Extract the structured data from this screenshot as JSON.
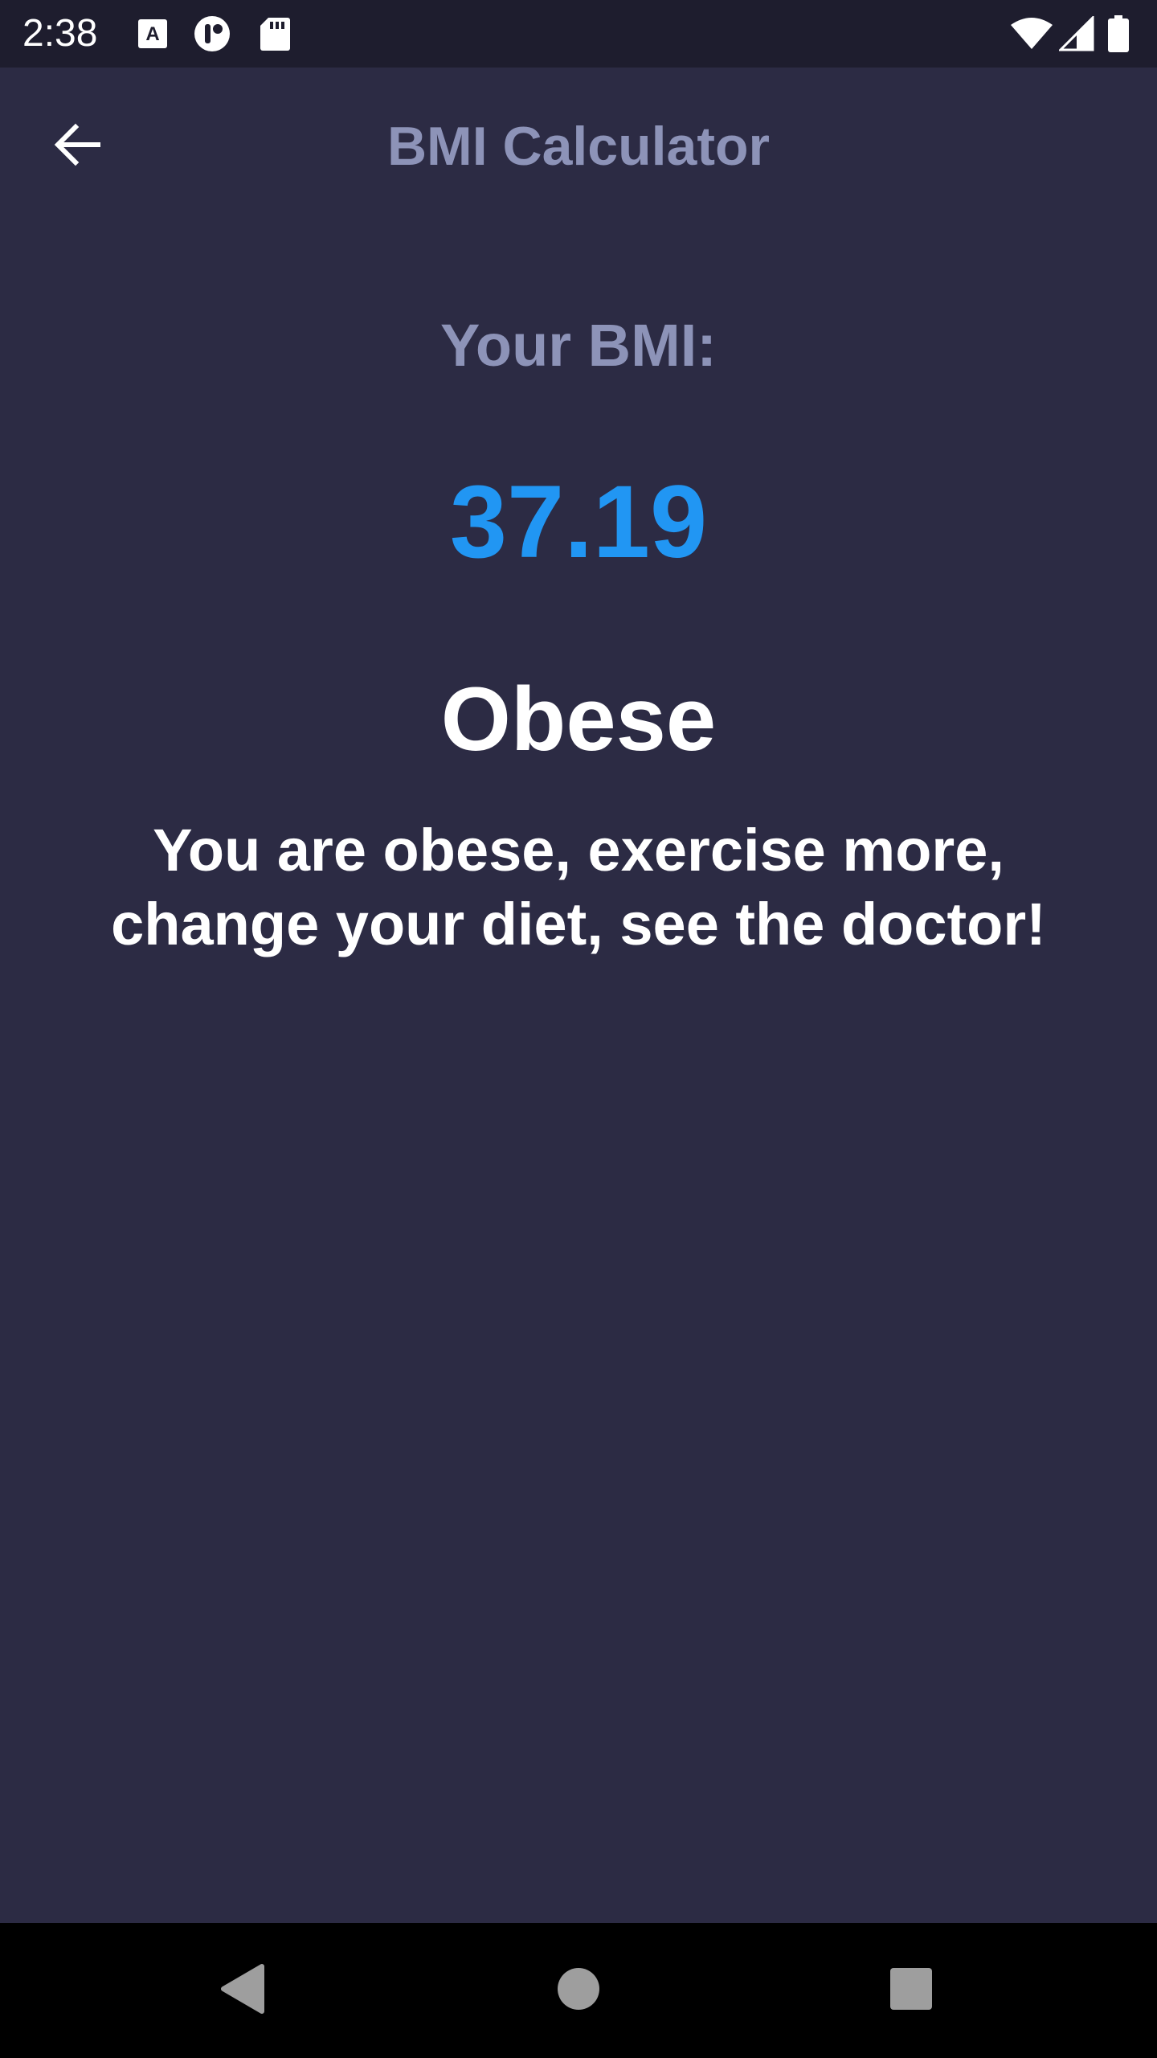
{
  "status_bar": {
    "time": "2:38",
    "icons": [
      "font-a-icon",
      "app-circle-icon",
      "sd-card-icon",
      "wifi-icon",
      "signal-icon",
      "battery-icon"
    ]
  },
  "app_bar": {
    "title": "BMI Calculator",
    "back_icon": "arrow-back-icon"
  },
  "result": {
    "heading": "Your BMI:",
    "value": "37.19",
    "category": "Obese",
    "advice": "You are obese, exercise more, change your diet, see the doctor!"
  },
  "nav_bar": {
    "icons": [
      "back-triangle-icon",
      "home-circle-icon",
      "recents-square-icon"
    ]
  },
  "colors": {
    "background": "#2C2B44",
    "status_bar": "#1E1D2E",
    "title_text": "#8D93B8",
    "bmi_value": "#2196F3",
    "text_white": "#FFFFFF",
    "nav_bar": "#000000",
    "nav_icon": "#9E9E9E"
  }
}
